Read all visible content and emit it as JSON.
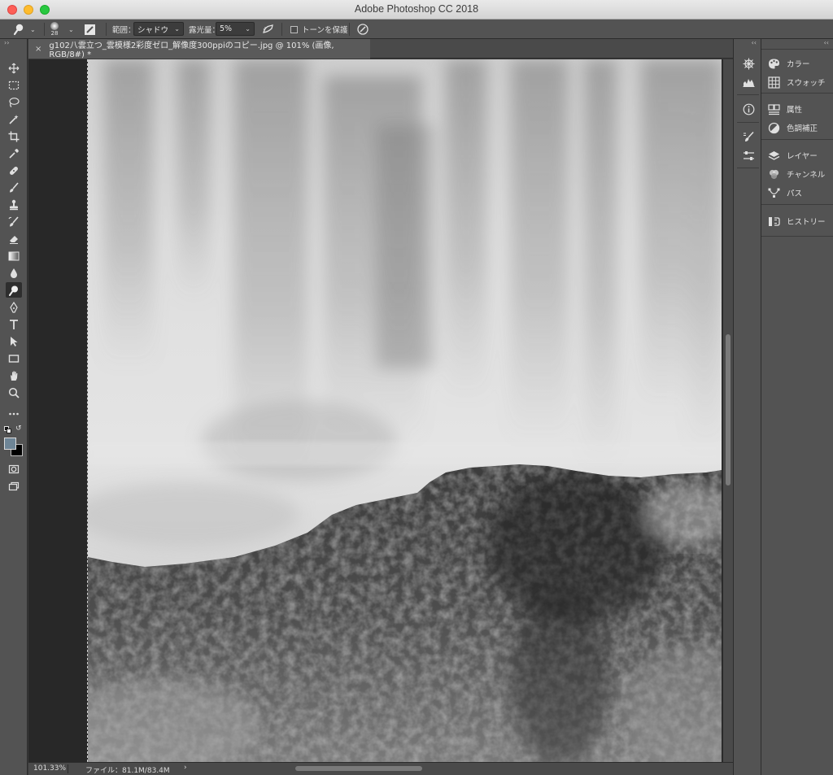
{
  "window": {
    "title": "Adobe Photoshop CC 2018"
  },
  "options_bar": {
    "brush_size": "28",
    "range_label": "範囲：",
    "range_value": "シャドウ",
    "exposure_label": "露光量：",
    "exposure_value": "5%",
    "protect_tones_label": "トーンを保護"
  },
  "document_tab": {
    "title": "g102八雲立つ_雲模様2彩度ゼロ_解像度300ppiのコピー.jpg @ 101% (画像, RGB/8#) *",
    "close": "×"
  },
  "status_bar": {
    "zoom": "101.33%",
    "file_info": "ファイル：81.1M/83.4M",
    "arrow": "›"
  },
  "tools": [
    "move-tool",
    "marquee-tool",
    "lasso-tool",
    "magic-wand-tool",
    "crop-tool",
    "eyedropper-tool",
    "healing-brush-tool",
    "brush-tool",
    "clone-stamp-tool",
    "history-brush-tool",
    "eraser-tool",
    "gradient-tool",
    "blur-tool",
    "dodge-tool",
    "pen-tool",
    "type-tool",
    "path-selection-tool",
    "rectangle-tool",
    "hand-tool",
    "zoom-tool",
    "more-tools"
  ],
  "colors": {
    "foreground": "#6e8596",
    "background": "#000000",
    "chrome": "#535353",
    "canvas_bg": "#282828"
  },
  "panels": {
    "color": "カラー",
    "swatches": "スウォッチ",
    "properties": "属性",
    "adjustments": "色調補正",
    "layers": "レイヤー",
    "channels": "チャンネル",
    "paths": "パス",
    "history": "ヒストリー"
  }
}
